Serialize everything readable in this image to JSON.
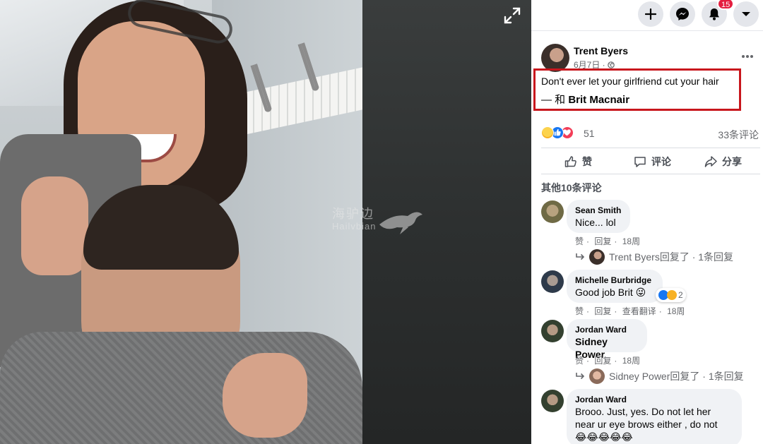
{
  "watermark": {
    "main": "海驴边",
    "sub": "Hailvbian"
  },
  "topbar": {
    "notifications_badge": "15"
  },
  "post": {
    "author": "Trent Byers",
    "date": "6月7日 · ",
    "text": "Don't ever let your girlfriend cut your hair",
    "tag_prefix": "— 和 ",
    "tagged": "Brit Macnair",
    "reaction_count": "51",
    "comment_count": "33条评论"
  },
  "actions": {
    "like": "赞",
    "comment": "评论",
    "share": "分享"
  },
  "more_comments_label": "其他10条评论",
  "comments": [
    {
      "name": "Sean Smith",
      "text": "Nice... lol",
      "like": "赞",
      "reply": "回复",
      "time": "18周",
      "reply_summary": "Trent Byers回复了 · 1条回复"
    },
    {
      "name": "Michelle Burbridge",
      "text": "Good job Brit 😜",
      "like": "赞",
      "reply": "回复",
      "translate": "查看翻译",
      "time": "18周",
      "reaction_count": "2"
    },
    {
      "name": "Jordan Ward",
      "text": "Sidney Power",
      "like": "赞",
      "reply": "回复",
      "time": "18周",
      "reply_summary": "Sidney Power回复了 · 1条回复"
    },
    {
      "name": "Jordan Ward",
      "text_line1": "Brooo. Just, yes. Do not let her",
      "text_line2": "near ur eye brows either , do not",
      "text_line3": "😂😂😂😂😂"
    }
  ],
  "colors": {
    "highlight": "#c8161d",
    "fb_blue": "#1877f2",
    "badge": "#e41e3f"
  }
}
